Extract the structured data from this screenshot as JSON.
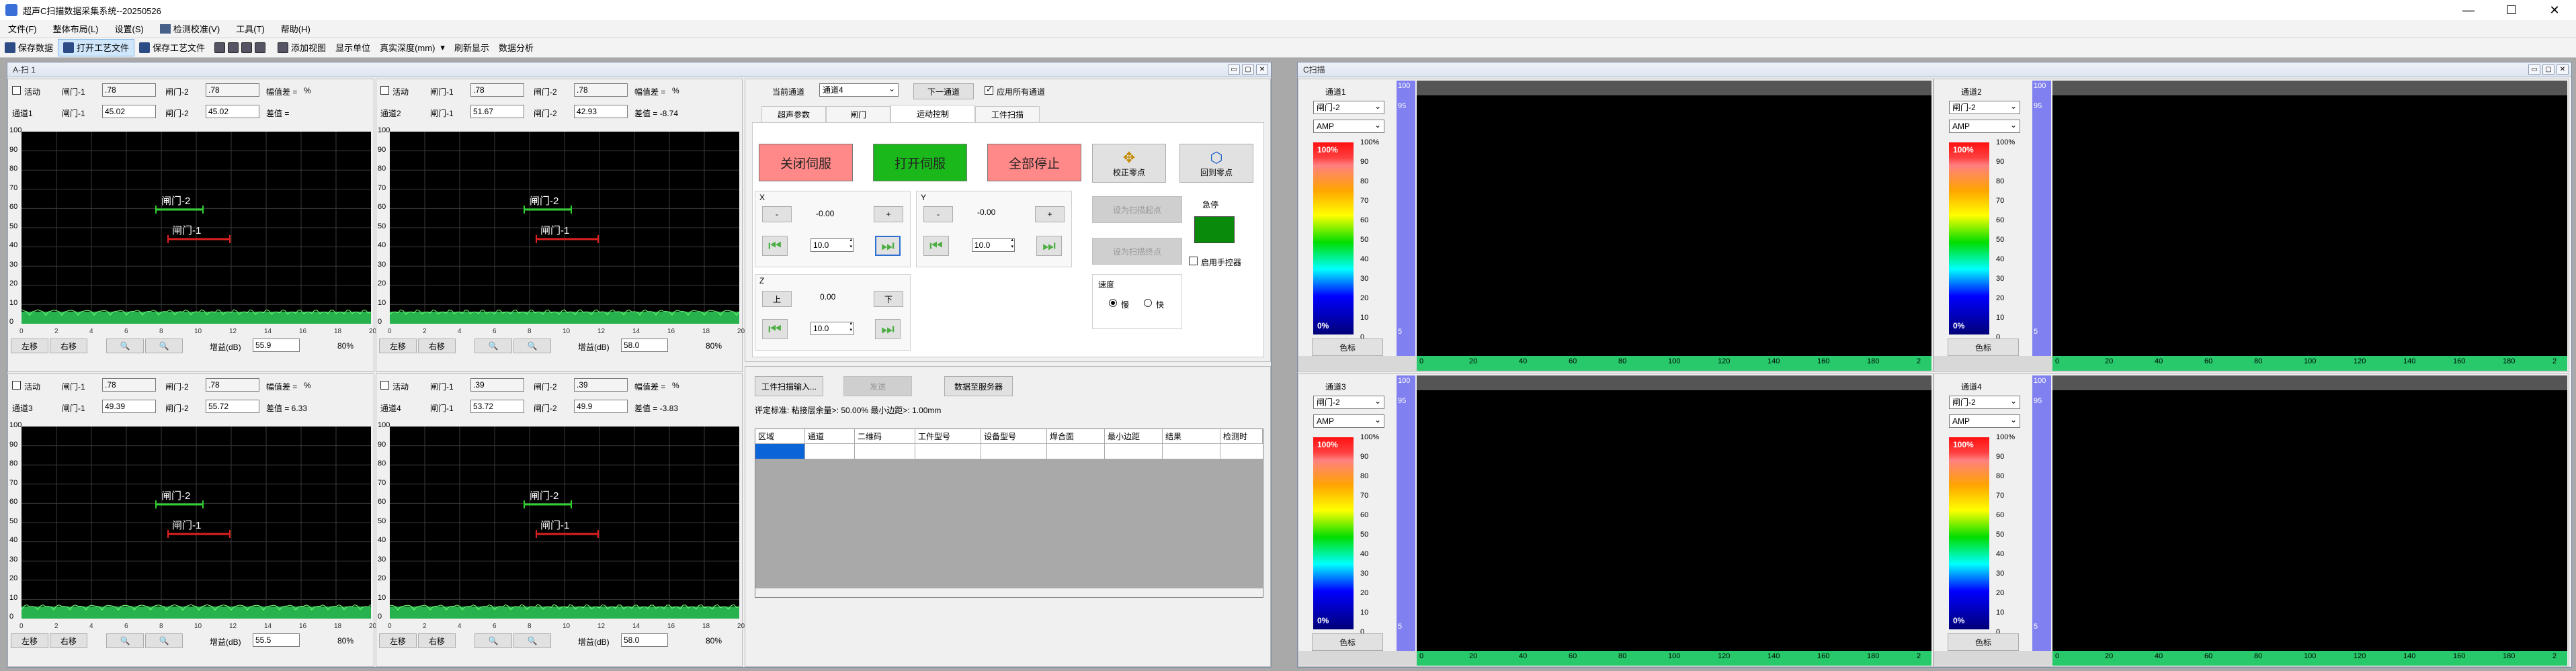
{
  "app": {
    "title": "超声C扫描数据采集系统--20250526"
  },
  "menu": [
    "文件(F)",
    "整体布局(L)",
    "设置(S)",
    "检测校准(V)",
    "工具(T)",
    "帮助(H)"
  ],
  "toolbar": [
    "保存数据",
    "打开工艺文件",
    "保存工艺文件",
    "添加视图",
    "显示单位",
    "真实深度(mm)",
    "刷新显示",
    "数据分析"
  ],
  "a_window": {
    "title": "A-扫 1"
  },
  "c_window": {
    "title": "C扫描"
  },
  "ascan_panels": [
    {
      "active": "活动",
      "gate1_label": "闸门-1",
      "gate2_label": "闸门-2",
      "gate1_top": ".78",
      "gate2_top": ".78",
      "amp_label": "幅值差 =",
      "unit": "%",
      "channel": "通道1",
      "gate1_val": "45.02",
      "gate2_val": "45.02",
      "diff": "差值 =",
      "left": "左移",
      "right": "右移",
      "gain_label": "增益(dB)",
      "gain": "55.9",
      "pct": "80%"
    },
    {
      "active": "活动",
      "gate1_label": "闸门-1",
      "gate2_label": "闸门-2",
      "gate1_top": ".78",
      "gate2_top": ".78",
      "amp_label": "幅值差 =",
      "unit": "%",
      "channel": "通道2",
      "gate1_val": "51.67",
      "gate2_val": "42.93",
      "diff": "差值 = -8.74",
      "left": "左移",
      "right": "右移",
      "gain_label": "增益(dB)",
      "gain": "58.0",
      "pct": "80%"
    },
    {
      "active": "活动",
      "gate1_label": "闸门-1",
      "gate2_label": "闸门-2",
      "gate1_top": ".78",
      "gate2_top": ".78",
      "amp_label": "幅值差 =",
      "unit": "%",
      "channel": "通道3",
      "gate1_val": "49.39",
      "gate2_val": "55.72",
      "diff": "差值 = 6.33",
      "left": "左移",
      "right": "右移",
      "gain_label": "增益(dB)",
      "gain": "55.5",
      "pct": "80%"
    },
    {
      "active": "活动",
      "gate1_label": "闸门-1",
      "gate2_label": "闸门-2",
      "gate1_top": ".39",
      "gate2_top": ".39",
      "amp_label": "幅值差 =",
      "unit": "%",
      "channel": "通道4",
      "gate1_val": "53.72",
      "gate2_val": "49.9",
      "diff": "差值 = -3.83",
      "left": "左移",
      "right": "右移",
      "gain_label": "增益(dB)",
      "gain": "58.0",
      "pct": "80%"
    }
  ],
  "ascan_y_ticks": [
    "100",
    "90",
    "80",
    "70",
    "60",
    "50",
    "40",
    "30",
    "20",
    "10",
    "0"
  ],
  "ascan_x_ticks": [
    "0",
    "2",
    "4",
    "6",
    "8",
    "10",
    "12",
    "14",
    "16",
    "18",
    "20"
  ],
  "ascan_gate_text": {
    "g1": "闸门-1",
    "g2": "闸门-2"
  },
  "control": {
    "current_channel_label": "当前通道",
    "current_channel": "通道4",
    "next_channel": "下一通道",
    "apply_all": "应用所有通道",
    "tabs": [
      "超声参数",
      "闸门",
      "运动控制",
      "工件扫描"
    ],
    "close_servo": "关闭伺服",
    "open_servo": "打开伺服",
    "stop_all": "全部停止",
    "x_label": "X",
    "y_label": "Y",
    "z_label": "Z",
    "minus": "-",
    "plus": "+",
    "up": "上",
    "down": "下",
    "x_pos": "-0.00",
    "y_pos": "-0.00",
    "z_pos": "0.00",
    "x_step": "10.0",
    "y_step": "10.0",
    "z_step": "10.0",
    "calib_origin": "校正零点",
    "return_origin": "回到零点",
    "set_start": "设为扫描起点",
    "set_end": "设为扫描终点",
    "urgent": "急停",
    "use_handwheel": "启用手控器",
    "speed": "速度",
    "slow": "慢",
    "fast": "快",
    "import_workpiece": "工件扫描输入...",
    "send": "发送",
    "data_to_server": "数据至服务器",
    "standard": "评定标准: 粘接层余量>: 50.00%  最小边距>: 1.00mm",
    "table_headers": [
      "区域",
      "通道",
      "二维码",
      "工件型号",
      "设备型号",
      "焊合面",
      "最小边距",
      "结果",
      "检测时"
    ]
  },
  "cscan_panels": [
    {
      "channel": "通道1",
      "gate": "闸门-2",
      "mode": "AMP",
      "palette_button": "色标"
    },
    {
      "channel": "通道2",
      "gate": "闸门-2",
      "mode": "AMP",
      "palette_button": "色标"
    },
    {
      "channel": "通道3",
      "gate": "闸门-2",
      "mode": "AMP",
      "palette_button": "色标"
    },
    {
      "channel": "通道4",
      "gate": "闸门-2",
      "mode": "AMP",
      "palette_button": "色标"
    }
  ],
  "palette_ticks": [
    "100%",
    "90",
    "80",
    "70",
    "60",
    "50",
    "40",
    "30",
    "20",
    "10",
    "0"
  ],
  "palette_top": "100%",
  "palette_bottom": "0%",
  "c_x_ticks": [
    "0",
    "20",
    "40",
    "60",
    "80",
    "100",
    "120",
    "140",
    "160",
    "180",
    "2"
  ],
  "c_y_ticks": [
    "100",
    "95",
    "5"
  ]
}
